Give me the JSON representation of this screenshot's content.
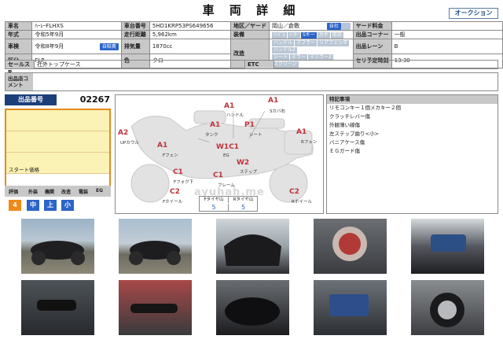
{
  "header": {
    "title": "車 両 詳 細",
    "auction_button": "オークション"
  },
  "info": {
    "car_name_label": "車名",
    "car_name": "ﾊｰﾚｰFLHXS",
    "model_label": "型式",
    "model": "",
    "frame_no_label": "車台番号",
    "frame_no": "5HD1KRP53PS649656",
    "region_label": "地区／ヤード",
    "region": "岡山／倉敷",
    "tax_badge": "自社",
    "tax_badge2": "",
    "yard_label": "ヤード料金",
    "yard_value": "",
    "year_label": "年式",
    "year": "令和5年9月",
    "mileage_label": "走行距離",
    "mileage": "5,962km",
    "equipment_label": "装備",
    "equip_opts": [
      "ﾊﾝﾄﾞﾙ",
      "ﾒｰﾀｰ",
      "Sキー",
      "カギ",
      "取説"
    ],
    "corner_label": "出品コーナー",
    "corner": "一般",
    "inspect_label": "車検",
    "inspect": "令和8年9月",
    "inspect_badge": "自賠責",
    "displacement_label": "排気量",
    "displacement": "1870cc",
    "features_label": "改造",
    "feat_opts": [
      "ハンドル",
      "マフラー",
      "リアフェンダ",
      "ハンドル2",
      "シート",
      "ミラー",
      "マフラー2",
      "スクリーン"
    ],
    "lane_label": "出品レーン",
    "lane": "B",
    "grade_label": "区分",
    "grade": "FLP",
    "color_label": "色",
    "color": "クロ",
    "start_time_label": "セリ予定時刻",
    "start_time": "13:30"
  },
  "sales_point": {
    "label": "セールスP",
    "value": "社外トップケース",
    "etc_label": "ETC",
    "etc_value": ""
  },
  "comment": {
    "label": "出品店コメント",
    "value": ""
  },
  "lot": {
    "label": "出品番号",
    "number": "02267",
    "start_price_label": "スタート価格",
    "grade_headers": [
      "評価",
      "外装",
      "機関",
      "改造",
      "電装",
      "EG"
    ],
    "grade_values": [
      "4",
      "中",
      "上",
      "小"
    ]
  },
  "diagram": {
    "watermark": "ayuhah.me",
    "marks": [
      {
        "code": "A1",
        "label": "ハンドル"
      },
      {
        "code": "A1",
        "label": "Sカバ右"
      },
      {
        "code": "A2",
        "label": "UPカウル"
      },
      {
        "code": "A1",
        "label": "タンク"
      },
      {
        "code": "P1",
        "label": "シート"
      },
      {
        "code": "A1",
        "label": "Rフェン"
      },
      {
        "code": "A1",
        "label": "Fフェン"
      },
      {
        "code": "W1C1",
        "label": "EG"
      },
      {
        "code": "W2",
        "label": "ステップ"
      },
      {
        "code": "C1",
        "label": "Fフォク下"
      },
      {
        "code": "C1",
        "label": "フレーム"
      },
      {
        "code": "C2",
        "label": "Fホイール"
      },
      {
        "code": "C2",
        "label": "Rホイール"
      }
    ],
    "tires": {
      "front_label": "Fタイヤ山",
      "front": "5",
      "rear_label": "Rタイヤ山",
      "rear": "5"
    }
  },
  "notes": {
    "header": "特記事項",
    "lines": [
      "リモコンキー１個メカキー２個",
      "クラッチレバー傷",
      "外観薄い線傷",
      "左ステップ曲り<小>",
      "バニアケース傷",
      "ＥＧガード傷"
    ]
  }
}
